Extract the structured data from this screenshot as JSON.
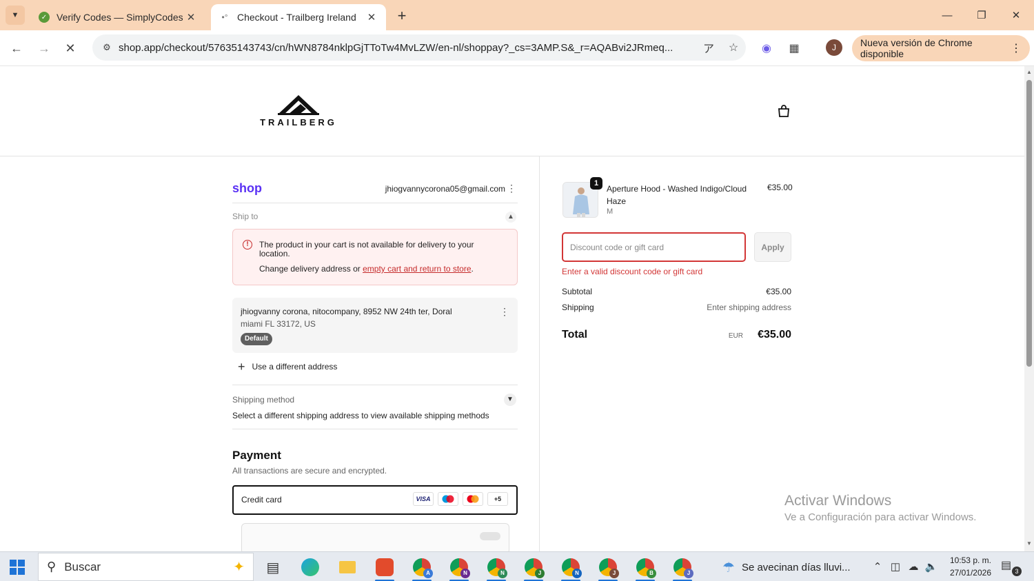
{
  "browser": {
    "tabs": [
      {
        "title": "Verify Codes — SimplyCodes",
        "favicon": "check-favicon"
      },
      {
        "title": "Checkout - Trailberg Ireland",
        "favicon": "loading-favicon"
      }
    ],
    "url": "shop.app/checkout/57635143743/cn/hWN8784nklpGjTToTw4MvLZW/en-nl/shoppay?_cs=3AMP.S&_r=AQABvi2JRmeq...",
    "profile_initial": "J",
    "update_banner": "Nueva versión de Chrome disponible"
  },
  "store": {
    "brand": "TRAILBERG"
  },
  "checkout": {
    "shop_label": "shop",
    "email": "jhiogvannycorona05@gmail.com",
    "ship_to_label": "Ship to",
    "error": {
      "title": "The product in your cart is not available for delivery to your location.",
      "sub_prefix": "Change delivery address or ",
      "sub_link": "empty cart and return to store",
      "sub_suffix": "."
    },
    "address": {
      "line1": "jhiogvanny corona, nitocompany, 8952 NW 24th ter, Doral",
      "line2": "miami FL 33172, US",
      "badge": "Default"
    },
    "different_address": "Use a different address",
    "shipping_method": {
      "label": "Shipping method",
      "text": "Select a different shipping address to view available shipping methods"
    },
    "payment": {
      "title": "Payment",
      "subtitle": "All transactions are secure and encrypted.",
      "method": "Credit card",
      "card_logos": [
        "VISA",
        "maestro",
        "mastercard",
        "+5"
      ]
    }
  },
  "summary": {
    "product": {
      "name": "Aperture Hood - Washed Indigo/Cloud Haze",
      "variant": "M",
      "price": "€35.00",
      "quantity": "1"
    },
    "discount": {
      "placeholder": "Discount code or gift card",
      "apply_label": "Apply",
      "error": "Enter a valid discount code or gift card"
    },
    "subtotal_label": "Subtotal",
    "subtotal_value": "€35.00",
    "shipping_label": "Shipping",
    "shipping_value": "Enter shipping address",
    "total_label": "Total",
    "total_currency": "EUR",
    "total_value": "€35.00"
  },
  "watermark": {
    "title": "Activar Windows",
    "subtitle": "Ve a Configuración para activar Windows."
  },
  "taskbar": {
    "search_placeholder": "Buscar",
    "weather": "Se avecinan días lluvi...",
    "time": "10:53 p. m.",
    "date": "27/01/2026",
    "notification_count": "3",
    "chrome_profiles": [
      "A",
      "N",
      "N",
      "J",
      "N",
      "J",
      "B",
      "J"
    ]
  },
  "colors": {
    "tab_strip": "#f9d6b8",
    "shop_purple": "#5a31f4",
    "error_red": "#d23535",
    "taskbar": "#e6eaf0"
  }
}
